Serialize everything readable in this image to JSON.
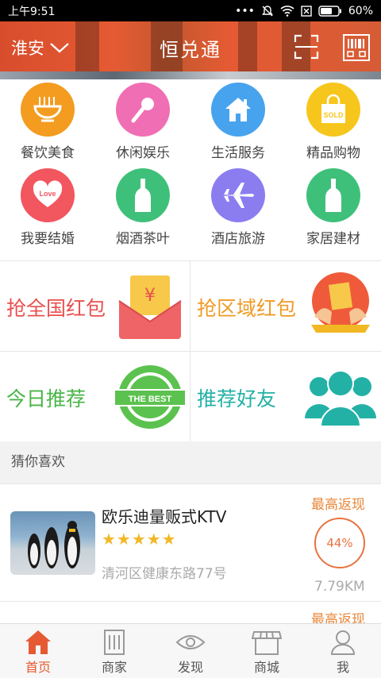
{
  "status": {
    "time": "上午9:51",
    "battery": "60%",
    "icons": [
      "dots-icon",
      "mute-icon",
      "wifi-icon",
      "sim-icon",
      "battery-icon"
    ]
  },
  "header": {
    "city": "淮安",
    "title": "恒兑通"
  },
  "categories": [
    {
      "label": "餐饮美食",
      "color": "#f39c1f",
      "icon": "noodles-icon"
    },
    {
      "label": "休闲娱乐",
      "color": "#f06fb4",
      "icon": "microphone-icon"
    },
    {
      "label": "生活服务",
      "color": "#47a3ee",
      "icon": "house-icon"
    },
    {
      "label": "精品购物",
      "color": "#f7c61c",
      "icon": "shopping-bag-icon",
      "badge": "SOLD"
    },
    {
      "label": "我要结婚",
      "color": "#f2565e",
      "icon": "love-heart-icon",
      "badge": "Love"
    },
    {
      "label": "烟酒茶叶",
      "color": "#3fc07a",
      "icon": "bottle-icon"
    },
    {
      "label": "酒店旅游",
      "color": "#8b7df0",
      "icon": "airplane-icon"
    },
    {
      "label": "家居建材",
      "color": "#3fc07a",
      "icon": "bottle-icon"
    }
  ],
  "promos": [
    {
      "label": "抢全国红包",
      "color": "#e8504f",
      "icon": "red-envelope-icon"
    },
    {
      "label": "抢区域红包",
      "color": "#ef9b26",
      "icon": "red-packet-hands-icon"
    },
    {
      "label": "今日推荐",
      "color": "#49b547",
      "icon": "the-best-badge-icon",
      "badge": "THE BEST"
    },
    {
      "label": "推荐好友",
      "color": "#23b1a6",
      "icon": "friends-group-icon"
    }
  ],
  "section": {
    "title": "猜你喜欢"
  },
  "listing": {
    "name": "欧乐迪量贩式KTV",
    "stars": "★★★★★",
    "address": "清河区健康东路77号",
    "max_label": "最高返现",
    "rebate": "44%",
    "distance": "7.79KM"
  },
  "listing2": {
    "max_label": "最高返现"
  },
  "tabs": [
    {
      "label": "首页",
      "icon": "home-icon",
      "active": true
    },
    {
      "label": "商家",
      "icon": "building-icon"
    },
    {
      "label": "发现",
      "icon": "eye-icon"
    },
    {
      "label": "商城",
      "icon": "store-icon"
    },
    {
      "label": "我",
      "icon": "user-icon"
    }
  ],
  "colors": {
    "accent": "#e55a33",
    "orange_text": "#e8873a"
  }
}
